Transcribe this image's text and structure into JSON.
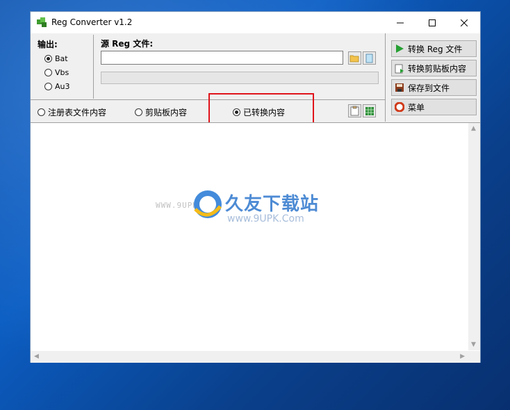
{
  "window": {
    "title": "Reg Converter v1.2",
    "controls": {
      "minimize": "minimize",
      "maximize": "maximize",
      "close": "close"
    }
  },
  "output": {
    "label": "输出:",
    "options": [
      {
        "label": "Bat",
        "checked": true
      },
      {
        "label": "Vbs",
        "checked": false
      },
      {
        "label": "Au3",
        "checked": false
      }
    ]
  },
  "source": {
    "label": "源 Reg 文件:",
    "value": "",
    "progress": 0
  },
  "actions": [
    {
      "label": "转换 Reg 文件",
      "icon": "play-icon"
    },
    {
      "label": "转换剪贴板内容",
      "icon": "clipboard-convert-icon"
    },
    {
      "label": "保存到文件",
      "icon": "save-icon"
    },
    {
      "label": "菜单",
      "icon": "lifebuoy-icon"
    }
  ],
  "view": {
    "options": [
      {
        "label": "注册表文件内容",
        "checked": false
      },
      {
        "label": "剪贴板内容",
        "checked": false
      },
      {
        "label": "已转换内容",
        "checked": true
      }
    ]
  },
  "watermark": {
    "prefix": "WWW.9UPK.COM",
    "title": "久友下载站",
    "sub": "www.9UPK.Com"
  },
  "colors": {
    "highlight": "#e0141b",
    "accent": "#3a7fd0"
  }
}
